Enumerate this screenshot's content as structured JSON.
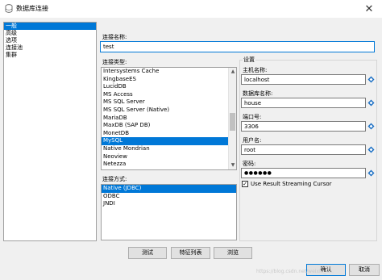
{
  "window": {
    "title": "数据库连接",
    "close_symbol": "✕"
  },
  "nav": {
    "items": [
      {
        "label": "一般",
        "selected": true
      },
      {
        "label": "高级",
        "selected": false
      },
      {
        "label": "选项",
        "selected": false
      },
      {
        "label": "连接池",
        "selected": false
      },
      {
        "label": "集群",
        "selected": false
      }
    ]
  },
  "form": {
    "connection_name_label": "连接名称:",
    "connection_name_value": "test",
    "connection_type_label": "连接类型:",
    "connection_types": [
      {
        "label": "Intersystems Cache",
        "selected": false
      },
      {
        "label": "KingbaseES",
        "selected": false
      },
      {
        "label": "LucidDB",
        "selected": false
      },
      {
        "label": "MS Access",
        "selected": false
      },
      {
        "label": "MS SQL Server",
        "selected": false
      },
      {
        "label": "MS SQL Server (Native)",
        "selected": false
      },
      {
        "label": "MariaDB",
        "selected": false
      },
      {
        "label": "MaxDB (SAP DB)",
        "selected": false
      },
      {
        "label": "MonetDB",
        "selected": false
      },
      {
        "label": "MySQL",
        "selected": true
      },
      {
        "label": "Native Mondrian",
        "selected": false
      },
      {
        "label": "Neoview",
        "selected": false
      },
      {
        "label": "Netezza",
        "selected": false
      }
    ],
    "access_method_label": "连接方式:",
    "access_methods": [
      {
        "label": "Native (JDBC)",
        "selected": true
      },
      {
        "label": "ODBC",
        "selected": false
      },
      {
        "label": "JNDI",
        "selected": false
      }
    ]
  },
  "settings": {
    "title": "设置",
    "host_label": "主机名称:",
    "host_value": "localhost",
    "db_label": "数据库名称:",
    "db_value": "house",
    "port_label": "端口号:",
    "port_value": "3306",
    "user_label": "用户名:",
    "user_value": "root",
    "password_label": "密码:",
    "password_value": "●●●●●●",
    "streaming_label": "Use Result Streaming Cursor",
    "streaming_checked": true,
    "check_mark": "✓"
  },
  "buttons": {
    "test": "测试",
    "features": "特征列表",
    "browse": "浏览",
    "ok": "确认",
    "cancel": "取消"
  },
  "watermark": "https://blog.csdn.net/weixin_4...",
  "colors": {
    "selection": "#0078d7",
    "spin_icon": "#1a6fc4"
  }
}
